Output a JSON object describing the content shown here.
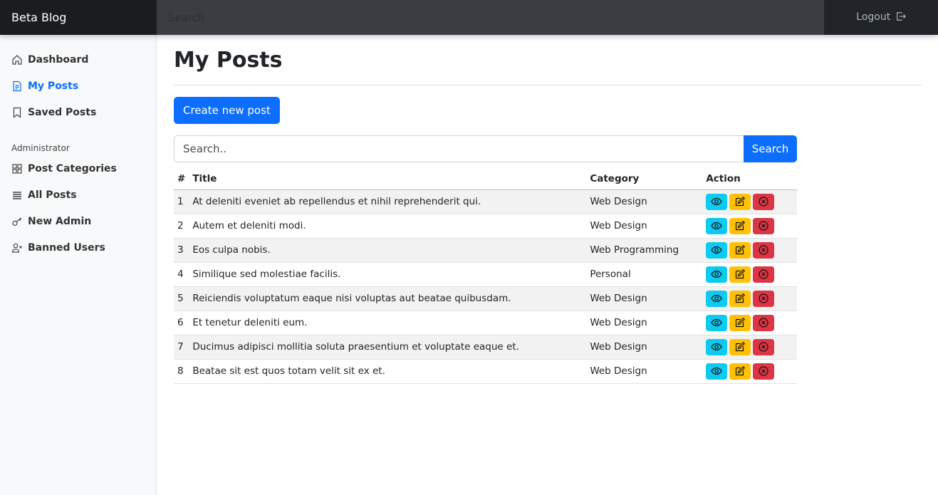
{
  "topbar": {
    "brand": "Beta Blog",
    "search_placeholder": "Search",
    "logout_label": "Logout"
  },
  "sidebar": {
    "items": [
      {
        "label": "Dashboard",
        "icon": "house-icon"
      },
      {
        "label": "My Posts",
        "icon": "file-text-icon",
        "active": true
      },
      {
        "label": "Saved Posts",
        "icon": "bookmark-icon"
      }
    ],
    "admin_heading": "Administrator",
    "admin_items": [
      {
        "label": "Post Categories",
        "icon": "grid-icon"
      },
      {
        "label": "All Posts",
        "icon": "list-icon"
      },
      {
        "label": "New Admin",
        "icon": "key-icon"
      },
      {
        "label": "Banned Users",
        "icon": "person-x-icon"
      }
    ]
  },
  "main": {
    "title": "My Posts",
    "create_label": "Create new post",
    "search_placeholder": "Search..",
    "search_button": "Search",
    "table": {
      "headers": [
        "#",
        "Title",
        "Category",
        "Action"
      ],
      "rows": [
        [
          "1",
          "At deleniti eveniet ab repellendus et nihil reprehenderit qui.",
          "Web Design"
        ],
        [
          "2",
          "Autem et deleniti modi.",
          "Web Design"
        ],
        [
          "3",
          "Eos culpa nobis.",
          "Web Programming"
        ],
        [
          "4",
          "Similique sed molestiae facilis.",
          "Personal"
        ],
        [
          "5",
          "Reiciendis voluptatum eaque nisi voluptas aut beatae quibusdam.",
          "Web Design"
        ],
        [
          "6",
          "Et tenetur deleniti eum.",
          "Web Design"
        ],
        [
          "7",
          "Ducimus adipisci mollitia soluta praesentium et voluptate eaque et.",
          "Web Design"
        ],
        [
          "8",
          "Beatae sit est quos totam velit sit ex et.",
          "Web Design"
        ]
      ]
    }
  },
  "colors": {
    "primary": "#0d6efd",
    "info": "#0dcaf0",
    "warning": "#ffc107",
    "danger": "#dc3545",
    "navbar": "#212529"
  }
}
